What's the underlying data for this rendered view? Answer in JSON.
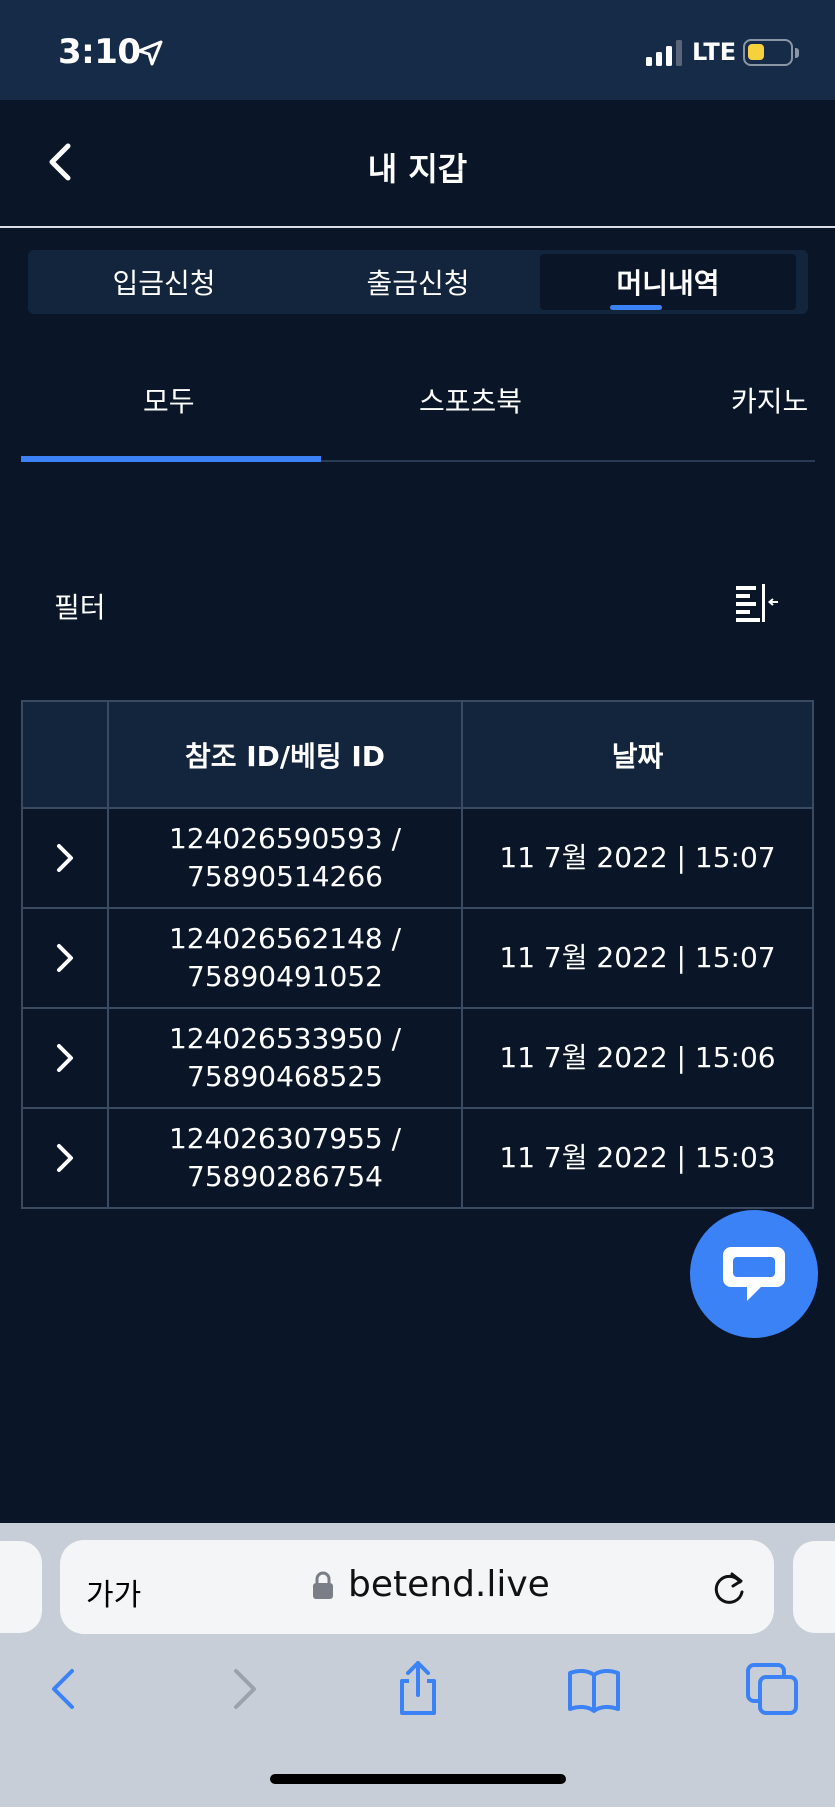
{
  "status_bar": {
    "time": "3:10",
    "network": "LTE",
    "battery_color": "#f5d23d"
  },
  "header": {
    "title": "내 지갑"
  },
  "top_tabs": [
    {
      "label": "입금신청"
    },
    {
      "label": "출금신청"
    },
    {
      "label": "머니내역",
      "active": true
    }
  ],
  "sub_tabs": [
    {
      "label": "모두",
      "active": true
    },
    {
      "label": "스포츠북"
    },
    {
      "label": "카지노"
    }
  ],
  "filter": {
    "label": "필터"
  },
  "table": {
    "headers": {
      "ref": "참조 ID/베팅 ID",
      "date": "날짜"
    },
    "rows": [
      {
        "ref_line1": "124026590593 /",
        "ref_line2": "75890514266",
        "date": "11 7월 2022 | 15:07"
      },
      {
        "ref_line1": "124026562148 /",
        "ref_line2": "75890491052",
        "date": "11 7월 2022 | 15:07"
      },
      {
        "ref_line1": "124026533950 /",
        "ref_line2": "75890468525",
        "date": "11 7월 2022 | 15:06"
      },
      {
        "ref_line1": "124026307955 /",
        "ref_line2": "75890286754",
        "date": "11 7월 2022 | 15:03"
      }
    ]
  },
  "browser": {
    "text_size_label": "가가",
    "url": "betend.live"
  },
  "colors": {
    "accent": "#3b82f6",
    "background": "#0a1628",
    "panel": "#13243d"
  },
  "icons": [
    "location-arrow-icon",
    "signal-icon",
    "battery-icon",
    "back-chevron-icon",
    "filter-icon",
    "chevron-right-icon",
    "chat-icon",
    "lock-icon",
    "reload-icon",
    "nav-back-icon",
    "nav-forward-icon",
    "share-icon",
    "bookmarks-icon",
    "tabs-icon"
  ]
}
